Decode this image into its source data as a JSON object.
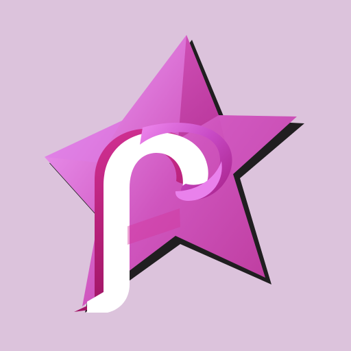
{
  "icon": {
    "name": "app-icon-star-letter-f",
    "background_color": "#dcc3dc",
    "star_color_light": "#e285e8",
    "star_color_dark": "#b42f93",
    "shadow_color": "#111111",
    "letter": "f",
    "letter_color": "#ffffff",
    "letter_shade_color": "#be267f"
  }
}
